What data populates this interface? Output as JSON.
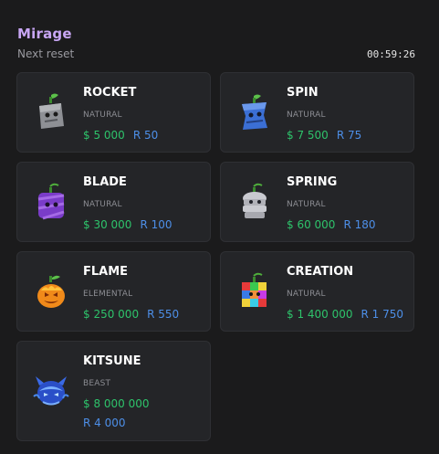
{
  "header": {
    "title": "Mirage",
    "subtitle": "Next reset",
    "timer": "00:59:26"
  },
  "fruits": [
    {
      "name": "ROCKET",
      "rarity": "NATURAL",
      "money": "$ 5 000",
      "robux": "R 50",
      "icon": "rocket-fruit-icon"
    },
    {
      "name": "SPIN",
      "rarity": "NATURAL",
      "money": "$ 7 500",
      "robux": "R 75",
      "icon": "spin-fruit-icon"
    },
    {
      "name": "BLADE",
      "rarity": "NATURAL",
      "money": "$ 30 000",
      "robux": "R 100",
      "icon": "blade-fruit-icon"
    },
    {
      "name": "SPRING",
      "rarity": "NATURAL",
      "money": "$ 60 000",
      "robux": "R 180",
      "icon": "spring-fruit-icon"
    },
    {
      "name": "FLAME",
      "rarity": "ELEMENTAL",
      "money": "$ 250 000",
      "robux": "R 550",
      "icon": "flame-fruit-icon"
    },
    {
      "name": "CREATION",
      "rarity": "NATURAL",
      "money": "$ 1 400 000",
      "robux": "R 1 750",
      "icon": "creation-fruit-icon"
    },
    {
      "name": "KITSUNE",
      "rarity": "BEAST",
      "money": "$ 8 000 000",
      "robux": "R 4 000",
      "icon": "kitsune-fruit-icon"
    }
  ],
  "colors": {
    "title": "#c8a6f4",
    "money": "#2ec36b",
    "robux": "#4d8fe8",
    "card": "#242528",
    "background": "#1b1b1c"
  }
}
